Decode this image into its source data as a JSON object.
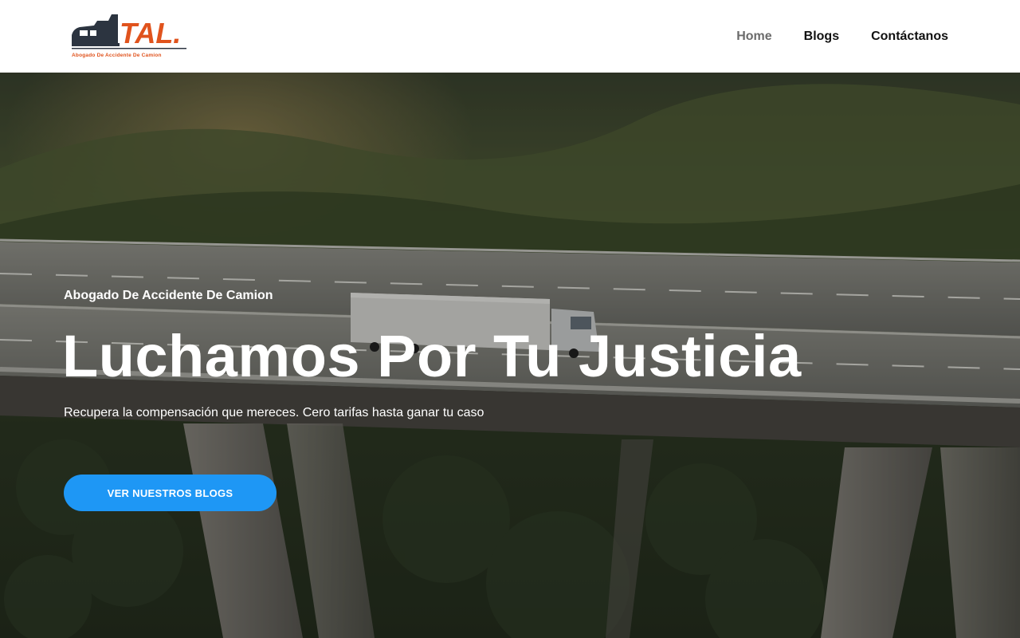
{
  "brand": {
    "logo_text": "TAL.",
    "tagline": "Abogado De Accidente De Camion",
    "colors": {
      "logo_dark": "#2c3440",
      "logo_orange": "#e0531d"
    }
  },
  "nav": {
    "items": [
      {
        "label": "Home",
        "active": true
      },
      {
        "label": "Blogs",
        "active": false
      },
      {
        "label": "Contáctanos",
        "active": false
      }
    ]
  },
  "hero": {
    "eyebrow": "Abogado De Accidente De Camion",
    "headline": "Luchamos Por Tu Justicia",
    "subtext": "Recupera la compensación que mereces. Cero tarifas hasta ganar tu caso",
    "cta_label": "VER NUESTROS BLOGS",
    "background_image": "aerial view of truck on highway viaduct over forested hills",
    "colors": {
      "cta": "#1e97f5"
    }
  }
}
